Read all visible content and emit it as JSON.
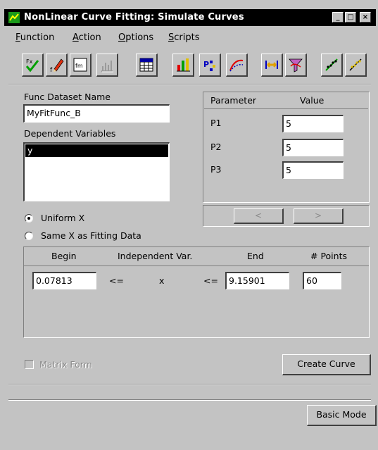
{
  "window": {
    "title": "NonLinear Curve Fitting:  Simulate Curves",
    "controls": [
      "_",
      "□",
      "×"
    ]
  },
  "menu": [
    {
      "underline": "F",
      "rest": "unction"
    },
    {
      "underline": "A",
      "rest": "ction"
    },
    {
      "underline": "O",
      "rest": "ptions"
    },
    {
      "underline": "S",
      "rest": "cripts"
    }
  ],
  "toolbar_icons": [
    "function-check-icon",
    "edit-function-icon",
    "formula-icon",
    "chart-disabled-icon",
    "worksheet-icon",
    "simulate-bars-icon",
    "parameters-icon",
    "curve-icon",
    "range-icon",
    "filter-icon",
    "fit-line-icon",
    "fit-line-alt-icon"
  ],
  "func_dataset": {
    "label": "Func Dataset Name",
    "value": "MyFitFunc_B"
  },
  "dependent_variables": {
    "label": "Dependent Variables",
    "items": [
      "y"
    ]
  },
  "parameters": {
    "header_parameter": "Parameter",
    "header_value": "Value",
    "rows": [
      {
        "name": "P1",
        "value": "5"
      },
      {
        "name": "P2",
        "value": "5"
      },
      {
        "name": "P3",
        "value": "5"
      }
    ],
    "prev_label": "<",
    "next_label": ">"
  },
  "options": {
    "uniform_x": "Uniform X",
    "same_x": "Same X as Fitting Data",
    "selected": "uniform_x"
  },
  "range": {
    "header_begin": "Begin",
    "header_indep": "Independent Var.",
    "header_end": "End",
    "header_points": "# Points",
    "begin": "0.07813",
    "op1": "<=",
    "var": "x",
    "op2": "<=",
    "end": "9.15901",
    "points": "60"
  },
  "matrix_form_label": "Matrix Form",
  "create_curve_label": "Create Curve",
  "basic_mode_label": "Basic Mode",
  "colors": {
    "window_bg": "#c3c3c3",
    "titlebar_bg": "#000000",
    "selection_bg": "#000000"
  }
}
